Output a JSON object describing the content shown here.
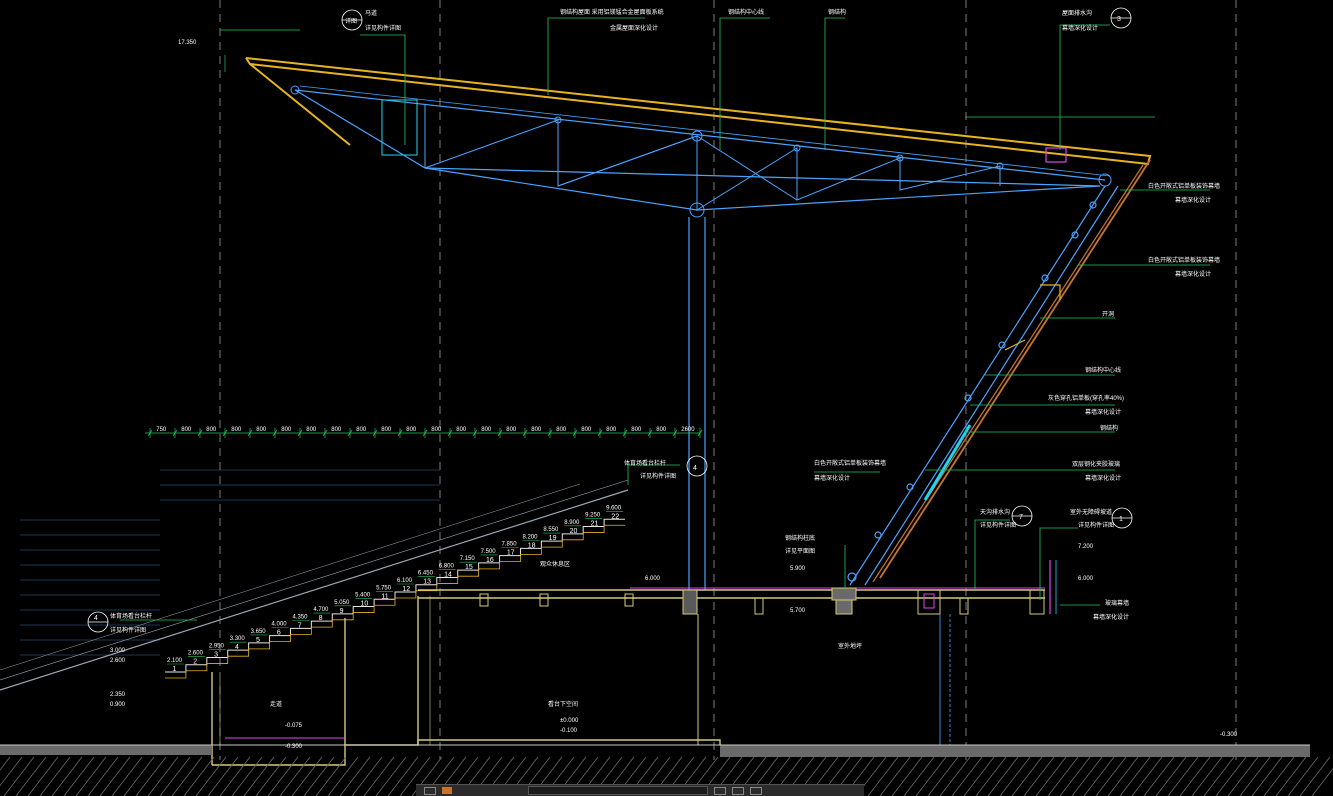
{
  "drawing": {
    "colors": {
      "background": "#000000",
      "structure": "#4aa3ff",
      "roof": "#e6b422",
      "leader": "#22c55e",
      "text": "#ffffff",
      "slab": "#d6c97a",
      "dim": "#d0d0d0",
      "magenta": "#d946ef",
      "orange": "#c8742c",
      "cyan": "#22d3ee"
    },
    "labels": {
      "tag_top_left": "马道",
      "tag_top_left_sub": "详见构件详图",
      "roof_main": "钢结构屋面 采用铝镁锰合金屋面板系统",
      "roof_main_sub": "金属屋面深化设计",
      "steel_center": "钢结构中心线",
      "steel": "钢结构",
      "gutter": "屋面排水沟",
      "gutter_sub": "幕墙深化设计",
      "elev_top": "17.350",
      "curtain_1": "白色开敞式铝单板装饰幕墙",
      "curtain_1_sub": "幕墙深化设计",
      "curtain_2": "白色开敞式铝单板装饰幕墙",
      "curtain_2_sub": "幕墙深化设计",
      "vent": "开洞",
      "steel_center_2": "钢结构中心线",
      "panel": "灰色穿孔铝单板(穿孔率40%)",
      "panel_sub": "幕墙深化设计",
      "steel_2": "钢结构",
      "glass": "双层钢化夹胶玻璃",
      "glass_sub": "幕墙深化设计",
      "awning": "白色开敞式铝单板装饰幕墙",
      "awning_sub": "幕墙深化设计",
      "stand_rail": "体育场看台栏杆",
      "stand_rail_sub": "详见构件详图",
      "stand_rail_2": "体育场看台栏杆",
      "stand_rail_2_sub": "详见构件详图",
      "platform_gutter": "天沟排水沟",
      "platform_gutter_sub": "详见构件详图",
      "outdoor": "室外无障碍坡道",
      "outdoor_sub": "详见构件详图",
      "steel_base": "钢结构柱底",
      "steel_base_sub": "详见平面图",
      "glass_screen": "玻璃幕墙",
      "glass_screen_sub": "幕墙深化设计",
      "ground_level": "室外地坪",
      "elev_stand_1": "3.000",
      "elev_stand_2": "2.600",
      "elev_stand_3": "2.350",
      "elev_stand_4": "0.900",
      "elev_deck_1": "6.000",
      "elev_deck_2": "5.900",
      "elev_deck_3": "5.700",
      "elev_right_1": "7.200",
      "elev_right_2": "6.000",
      "elev_ground": "-0.300",
      "elev_low_1": "-0.075",
      "elev_low_2": "-0.300",
      "elev_mid_1": "±0.000",
      "elev_mid_2": "-0.100",
      "room_1": "走道",
      "room_2": "看台下空间",
      "room_3": "观众休息区",
      "tag_1": "1",
      "tag_3": "3",
      "tag_4": "4",
      "tag_7": "7",
      "tag_sub": "详图"
    },
    "stair_rows": [
      "1",
      "2",
      "3",
      "4",
      "5",
      "6",
      "7",
      "8",
      "9",
      "10",
      "11",
      "12",
      "13",
      "14",
      "15",
      "16",
      "17",
      "18",
      "19",
      "20",
      "21",
      "22"
    ],
    "row_elevations": [
      "2.100",
      "2.600",
      "2.950",
      "3.300",
      "3.650",
      "4.000",
      "4.350",
      "4.700",
      "5.050",
      "5.400",
      "5.750",
      "6.100",
      "6.450",
      "6.800",
      "7.150",
      "7.500",
      "7.850",
      "8.200",
      "8.550",
      "8.900",
      "9.250",
      "9.600"
    ],
    "dimension_values": [
      "750",
      "800",
      "800",
      "800",
      "800",
      "800",
      "800",
      "800",
      "800",
      "800",
      "800",
      "800",
      "800",
      "800",
      "800",
      "800",
      "800",
      "800",
      "800",
      "800",
      "800",
      "2600"
    ]
  }
}
